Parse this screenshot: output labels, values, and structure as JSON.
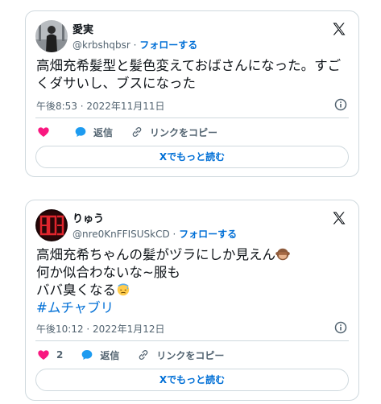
{
  "tweets": [
    {
      "display_name": "愛実",
      "handle": "@krbshqbsr",
      "separator": " · ",
      "follow_label": "フォローする",
      "text_lines": [
        "高畑充希髪型と髪色変えておばさんになった。すご",
        "くダサいし、ブスになった"
      ],
      "timestamp": "午後8:53 · 2022年11月11日",
      "like_count": "",
      "reply_label": "返信",
      "copy_link_label": "リンクをコピー",
      "read_more_label": "Xでもっと読む"
    },
    {
      "display_name": "りゅう",
      "handle": "@nre0KnFFISUSkCD",
      "separator": " · ",
      "follow_label": "フォローする",
      "text_lines": [
        "高畑充希ちゃんの髪がヅラにしか見えん",
        "何か似合わないな~服も",
        "ババ臭くなる"
      ],
      "hashtag": "#ムチャブリ",
      "timestamp": "午後10:12 · 2022年1月12日",
      "like_count": "2",
      "reply_label": "返信",
      "copy_link_label": "リンクをコピー",
      "read_more_label": "Xでもっと読む"
    }
  ],
  "icons": {
    "x_logo": "x-logo-icon",
    "info": "info-icon",
    "like": "heart-icon",
    "reply": "reply-bubble-icon",
    "copy_link": "link-icon"
  },
  "colors": {
    "like": "#f91880",
    "reply": "#1d9bf0",
    "link_blue": "#006fd6",
    "secondary_text": "#536471",
    "border": "#cfd9de"
  }
}
